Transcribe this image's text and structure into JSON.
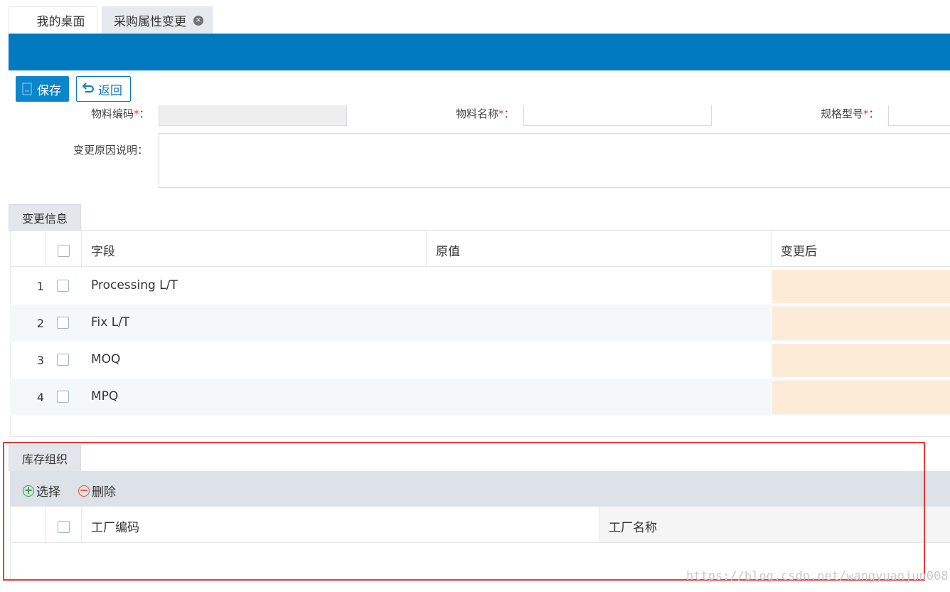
{
  "tabs": [
    {
      "label": "我的桌面"
    },
    {
      "label": "采购属性变更",
      "close": "×"
    }
  ],
  "toolbar": {
    "save_label": "保存",
    "back_label": "返回"
  },
  "form": {
    "material_code_label": "物料编码",
    "material_name_label": "物料名称",
    "spec_model_label": "规格型号",
    "required_mark": "*",
    "colon": "：",
    "reason_label": "变更原因说明："
  },
  "change_info": {
    "section_title": "变更信息",
    "columns": [
      "字段",
      "原值",
      "变更后"
    ],
    "rows": [
      {
        "num": "1",
        "field": "Processing L/T"
      },
      {
        "num": "2",
        "field": "Fix L/T"
      },
      {
        "num": "3",
        "field": "MOQ"
      },
      {
        "num": "4",
        "field": "MPQ"
      }
    ]
  },
  "inventory_org": {
    "section_title": "库存组织",
    "select_label": "选择",
    "delete_label": "删除",
    "columns": [
      "工厂编码",
      "工厂名称"
    ]
  },
  "watermark": "https://blog.csdn.net/wangyuanjun008",
  "colors": {
    "header_blue": "#0079bf",
    "changed_cell": "#fdebd8",
    "highlight_box": "#e8393a"
  }
}
